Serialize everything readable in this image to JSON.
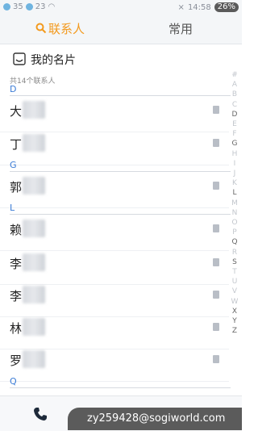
{
  "status": {
    "left_numbers": [
      "35",
      "23"
    ],
    "time": "14:58",
    "battery": "26%"
  },
  "tabs": [
    {
      "label": "联系人",
      "active": true
    },
    {
      "label": "常用",
      "active": false
    }
  ],
  "my_card": {
    "label": "我的名片"
  },
  "count_text": "共14个联系人",
  "sections": [
    {
      "letter": "D",
      "contacts": [
        "大",
        "丁"
      ]
    },
    {
      "letter": "G",
      "contacts": [
        "郭"
      ]
    },
    {
      "letter": "L",
      "contacts": [
        "赖",
        "李",
        "李",
        "林",
        "罗"
      ]
    },
    {
      "letter": "Q",
      "contacts": []
    }
  ],
  "index_letters": [
    "#",
    "A",
    "B",
    "C",
    "D",
    "E",
    "F",
    "G",
    "H",
    "I",
    "J",
    "K",
    "L",
    "M",
    "N",
    "O",
    "P",
    "Q",
    "R",
    "S",
    "T",
    "U",
    "V",
    "W",
    "X",
    "Y",
    "Z"
  ],
  "index_active": [
    "D",
    "G",
    "L",
    "Q",
    "S",
    "X",
    "Y",
    "Z"
  ],
  "bottom_icons": [
    "phone-icon",
    "add-icon",
    "sync-icon"
  ],
  "watermark": "zy259428@sogiworld.com",
  "colors": {
    "accent": "#f39a1e",
    "section": "#3a7bd5"
  }
}
